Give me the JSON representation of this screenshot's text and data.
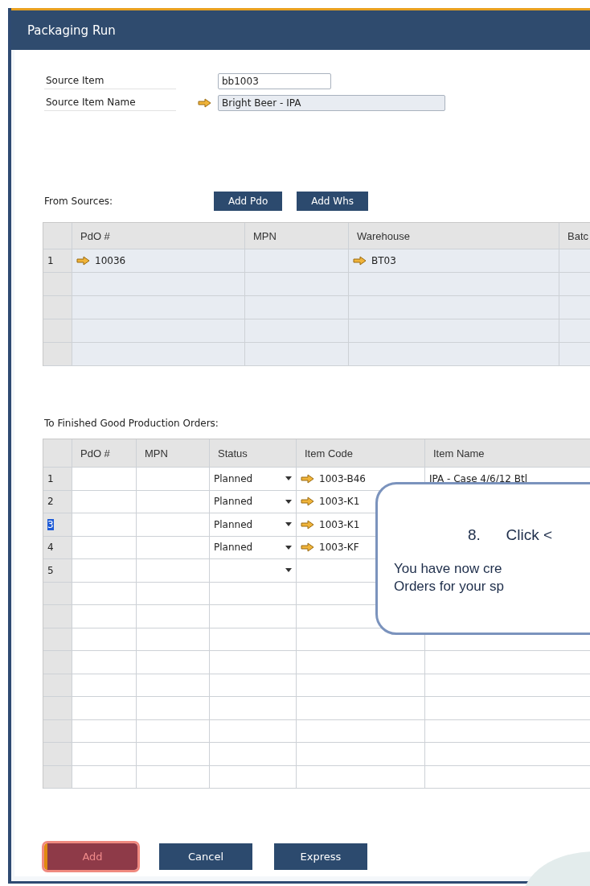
{
  "window": {
    "title": "Packaging Run"
  },
  "fields": [
    {
      "label": "Source Item",
      "value": "bb1003",
      "link": false,
      "readonly": false
    },
    {
      "label": "Source Item Name",
      "value": "Bright Beer - IPA",
      "link": true,
      "readonly": true
    }
  ],
  "sources": {
    "label": "From Sources:",
    "buttons": [
      "Add Pdo",
      "Add Whs"
    ],
    "columns": [
      "PdO #",
      "MPN",
      "Warehouse",
      "Batc"
    ],
    "rows": [
      {
        "number": "1",
        "pdo": "10036",
        "warehouse": "BT03"
      }
    ]
  },
  "orders": {
    "label": "To Finished Good Production Orders:",
    "columns": [
      "PdO #",
      "MPN",
      "Status",
      "Item Code",
      "Item Name"
    ],
    "rows": [
      {
        "number": "1",
        "status": "Planned",
        "item_code": "1003-B46",
        "item_name": "IPA - Case 4/6/12 Btl",
        "selected": false
      },
      {
        "number": "2",
        "status": "Planned",
        "item_code": "1003-K1",
        "selected": false
      },
      {
        "number": "3",
        "status": "Planned",
        "item_code": "1003-K1",
        "selected": true
      },
      {
        "number": "4",
        "status": "Planned",
        "item_code": "1003-KF",
        "selected": false
      },
      {
        "number": "5",
        "selected": false
      }
    ]
  },
  "buttons": [
    {
      "label": "Add",
      "highlighted": true
    },
    {
      "label": "Cancel",
      "highlighted": false
    },
    {
      "label": "Express",
      "highlighted": false
    }
  ],
  "callout": {
    "step": "8.",
    "title": "Click <",
    "lines": [
      "You have now cre",
      "Orders for your sp"
    ]
  }
}
